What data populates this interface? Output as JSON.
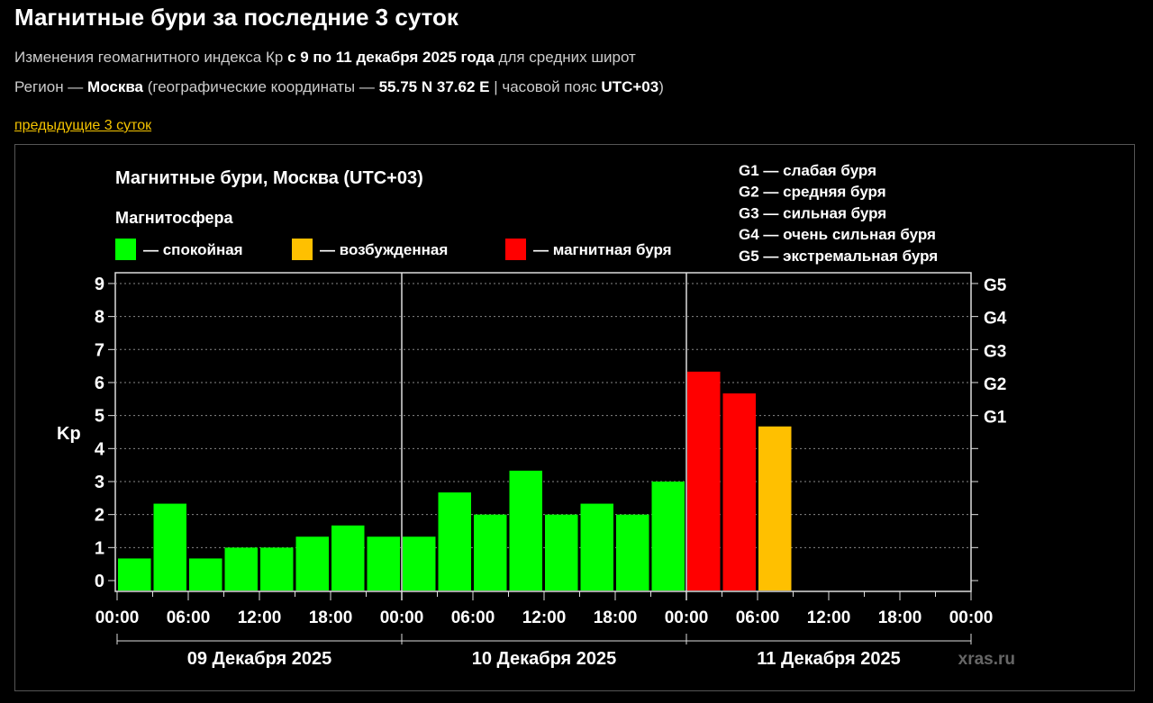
{
  "header": {
    "title": "Магнитные бури за последние 3 суток",
    "line1": [
      "Изменения геомагнитного индекса Кр ",
      "с 9 по 11 декабря 2025 года",
      " для средних широт"
    ],
    "line2": [
      "Регион — ",
      "Москва",
      " (географические координаты — ",
      "55.75 N 37.62 E",
      " | часовой пояс ",
      "UTC+03",
      ")"
    ],
    "prev_link": "предыдущие 3 суток"
  },
  "colors": {
    "quiet": "#00ff00",
    "excited": "#ffc000",
    "storm": "#ff0000"
  },
  "chart_data": {
    "type": "bar",
    "title": "Магнитные бури, Москва (UTC+03)",
    "legend_title": "Магнитосфера",
    "legend": [
      "— спокойная",
      "— возбужденная",
      "— магнитная буря"
    ],
    "g_legend": [
      "G1 — слабая буря",
      "G2 — средняя буря",
      "G3 — сильная буря",
      "G4 — очень сильная буря",
      "G5 — экстремальная буря"
    ],
    "ylabel": "Kp",
    "ylim": [
      0,
      9
    ],
    "yticks": [
      "0",
      "1",
      "2",
      "3",
      "4",
      "5",
      "6",
      "7",
      "8",
      "9"
    ],
    "g_ticks": [
      "G1",
      "G2",
      "G3",
      "G4",
      "G5"
    ],
    "xtick_labels": [
      "00:00",
      "06:00",
      "12:00",
      "18:00",
      "00:00",
      "06:00",
      "12:00",
      "18:00",
      "00:00",
      "06:00",
      "12:00",
      "18:00",
      "00:00"
    ],
    "days": [
      "09 Декабря 2025",
      "10 Декабря 2025",
      "11 Декабря 2025"
    ],
    "values": [
      0.67,
      2.33,
      0.67,
      1,
      1,
      1.33,
      1.67,
      1.33,
      1.33,
      2.67,
      2,
      3.33,
      2,
      2.33,
      2,
      3,
      6.33,
      5.67,
      4.67
    ],
    "status": [
      "quiet",
      "quiet",
      "quiet",
      "quiet",
      "quiet",
      "quiet",
      "quiet",
      "quiet",
      "quiet",
      "quiet",
      "quiet",
      "quiet",
      "quiet",
      "quiet",
      "quiet",
      "quiet",
      "storm",
      "storm",
      "excited"
    ],
    "watermark": "xras.ru"
  }
}
